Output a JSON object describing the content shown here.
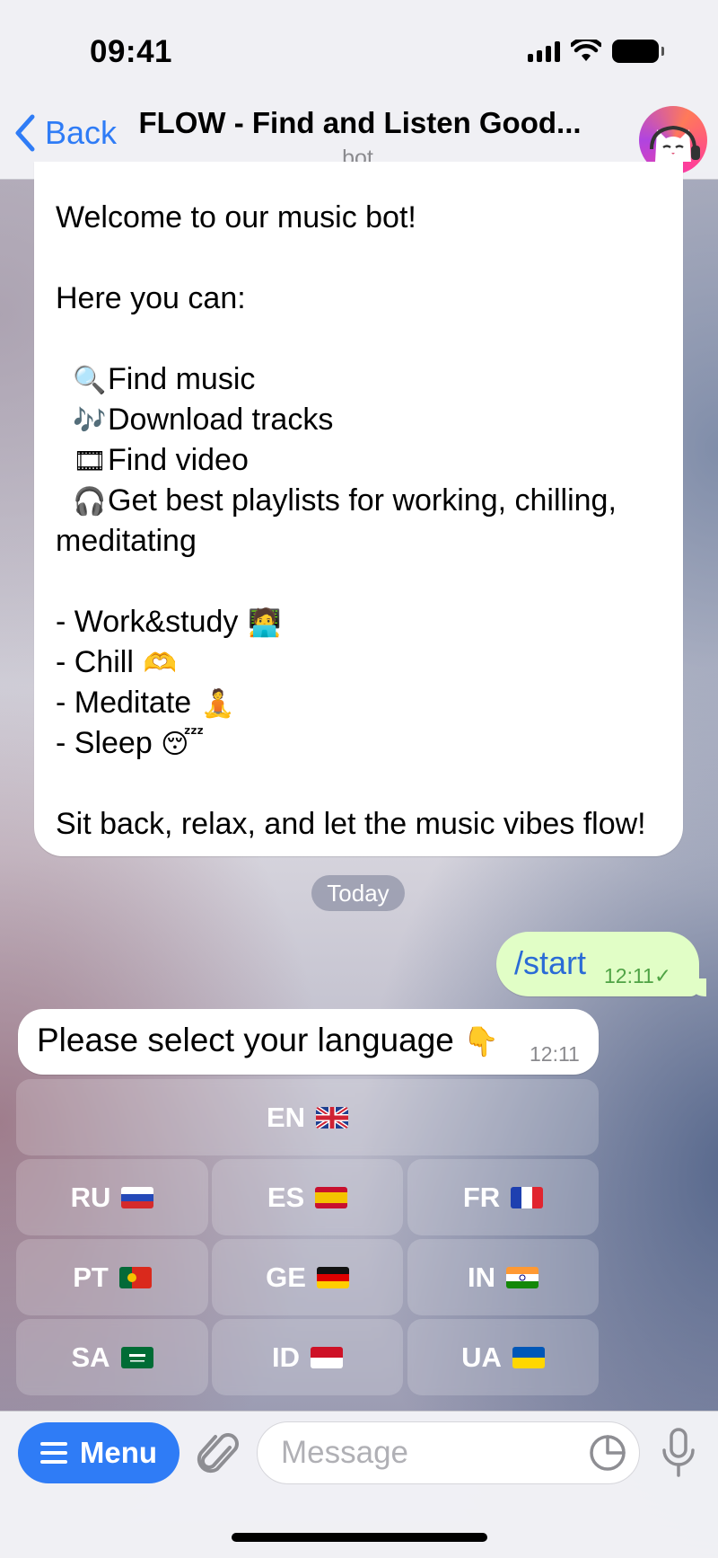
{
  "status_bar": {
    "time": "09:41"
  },
  "header": {
    "back_label": "Back",
    "title": "FLOW - Find and Listen Good...",
    "subtitle": "bot"
  },
  "welcome_message": {
    "lines": [
      "Welcome to our music bot!",
      "",
      "Here you can:",
      "",
      "Find music",
      "Download tracks",
      "Find video",
      "Get best playlists for working, chilling,",
      "meditating",
      "",
      "- Work&study",
      "- Chill",
      "- Meditate",
      "- Sleep",
      "",
      "Sit back, relax, and let the music vibes flow!"
    ],
    "icons": {
      "find_music": "🔍",
      "download_tracks": "🎶",
      "find_video": "🎞",
      "playlists": "🎧",
      "work": "🧑‍💻",
      "chill": "🫶",
      "meditate": "🧘",
      "sleep": "😴"
    }
  },
  "date_separator": "Today",
  "outgoing_message": {
    "text": "/start",
    "time": "12:11",
    "status": "✓"
  },
  "incoming_message": {
    "text": "Please select your language",
    "emoji": "👇",
    "time": "12:11"
  },
  "language_buttons": [
    {
      "code": "EN",
      "flag": "uk"
    },
    {
      "code": "RU",
      "flag": "ru"
    },
    {
      "code": "ES",
      "flag": "es"
    },
    {
      "code": "FR",
      "flag": "fr"
    },
    {
      "code": "PT",
      "flag": "pt"
    },
    {
      "code": "GE",
      "flag": "de"
    },
    {
      "code": "IN",
      "flag": "in"
    },
    {
      "code": "SA",
      "flag": "sa"
    },
    {
      "code": "ID",
      "flag": "id"
    },
    {
      "code": "UA",
      "flag": "ua"
    }
  ],
  "input_bar": {
    "menu_label": "Menu",
    "message_placeholder": "Message"
  },
  "colors": {
    "accent": "#2f7cf6",
    "outgoing_bubble": "#e1fec6",
    "incoming_bubble": "#ffffff"
  }
}
